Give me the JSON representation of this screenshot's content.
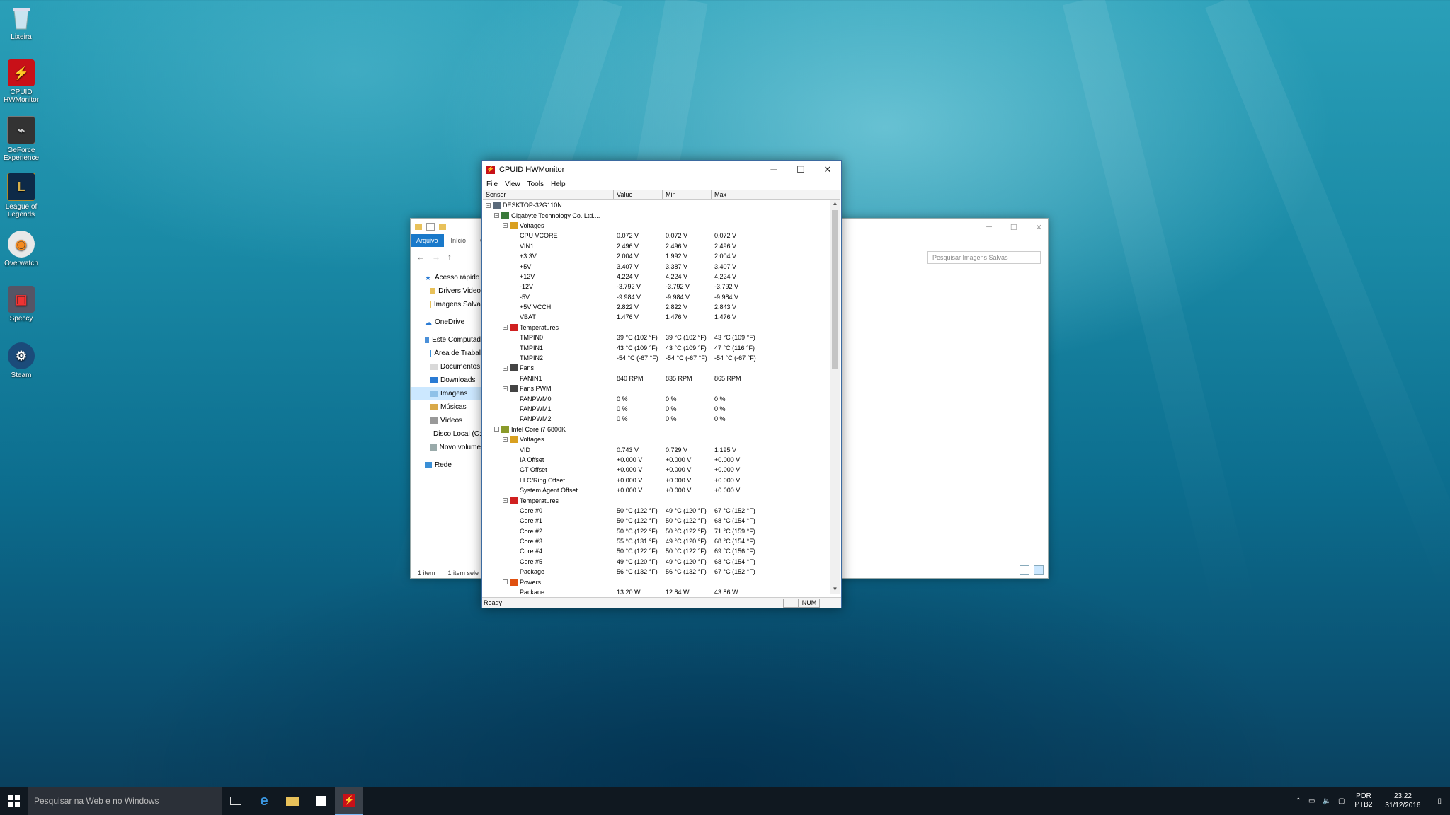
{
  "desktop": {
    "icons": [
      {
        "label": "Lixeira"
      },
      {
        "label": "CPUID HWMonitor"
      },
      {
        "label": "GeForce Experience"
      },
      {
        "label": "League of Legends"
      },
      {
        "label": "Overwatch"
      },
      {
        "label": "Speccy"
      },
      {
        "label": "Steam"
      }
    ]
  },
  "explorer": {
    "ribbon": {
      "file": "Arquivo",
      "home": "Início",
      "share": "C"
    },
    "search_placeholder": "Pesquisar Imagens Salvas",
    "nav": [
      "Acesso rápido",
      "Drivers Video",
      "Imagens Salva",
      "OneDrive",
      "Este Computad",
      "Área de Trabal",
      "Documentos",
      "Downloads",
      "Imagens",
      "Músicas",
      "Vídeos",
      "Disco Local (C:",
      "Novo volume",
      "Rede"
    ],
    "status": {
      "count": "1 item",
      "selected": "1 item sele"
    }
  },
  "hwmonitor": {
    "title": "CPUID HWMonitor",
    "menu": [
      "File",
      "View",
      "Tools",
      "Help"
    ],
    "columns": [
      "Sensor",
      "Value",
      "Min",
      "Max"
    ],
    "rows": [
      {
        "name": "DESKTOP-32G110N",
        "value": "",
        "min": "",
        "max": ""
      },
      {
        "name": "Gigabyte Technology Co. Ltd....",
        "value": "",
        "min": "",
        "max": ""
      },
      {
        "name": "Voltages",
        "value": "",
        "min": "",
        "max": ""
      },
      {
        "name": "CPU VCORE",
        "value": "0.072 V",
        "min": "0.072 V",
        "max": "0.072 V"
      },
      {
        "name": "VIN1",
        "value": "2.496 V",
        "min": "2.496 V",
        "max": "2.496 V"
      },
      {
        "name": "+3.3V",
        "value": "2.004 V",
        "min": "1.992 V",
        "max": "2.004 V"
      },
      {
        "name": "+5V",
        "value": "3.407 V",
        "min": "3.387 V",
        "max": "3.407 V"
      },
      {
        "name": "+12V",
        "value": "4.224 V",
        "min": "4.224 V",
        "max": "4.224 V"
      },
      {
        "name": "-12V",
        "value": "-3.792 V",
        "min": "-3.792 V",
        "max": "-3.792 V"
      },
      {
        "name": "-5V",
        "value": "-9.984 V",
        "min": "-9.984 V",
        "max": "-9.984 V"
      },
      {
        "name": "+5V VCCH",
        "value": "2.822 V",
        "min": "2.822 V",
        "max": "2.843 V"
      },
      {
        "name": "VBAT",
        "value": "1.476 V",
        "min": "1.476 V",
        "max": "1.476 V"
      },
      {
        "name": "Temperatures",
        "value": "",
        "min": "",
        "max": ""
      },
      {
        "name": "TMPIN0",
        "value": "39 °C  (102 °F)",
        "min": "39 °C  (102 °F)",
        "max": "43 °C  (109 °F)"
      },
      {
        "name": "TMPIN1",
        "value": "43 °C  (109 °F)",
        "min": "43 °C  (109 °F)",
        "max": "47 °C  (116 °F)"
      },
      {
        "name": "TMPIN2",
        "value": "-54 °C  (-67 °F)",
        "min": "-54 °C  (-67 °F)",
        "max": "-54 °C  (-67 °F)"
      },
      {
        "name": "Fans",
        "value": "",
        "min": "",
        "max": ""
      },
      {
        "name": "FANIN1",
        "value": "840 RPM",
        "min": "835 RPM",
        "max": "865 RPM"
      },
      {
        "name": "Fans PWM",
        "value": "",
        "min": "",
        "max": ""
      },
      {
        "name": "FANPWM0",
        "value": "0 %",
        "min": "0 %",
        "max": "0 %"
      },
      {
        "name": "FANPWM1",
        "value": "0 %",
        "min": "0 %",
        "max": "0 %"
      },
      {
        "name": "FANPWM2",
        "value": "0 %",
        "min": "0 %",
        "max": "0 %"
      },
      {
        "name": "Intel Core i7 6800K",
        "value": "",
        "min": "",
        "max": ""
      },
      {
        "name": "Voltages",
        "value": "",
        "min": "",
        "max": ""
      },
      {
        "name": "VID",
        "value": "0.743 V",
        "min": "0.729 V",
        "max": "1.195 V"
      },
      {
        "name": "IA Offset",
        "value": "+0.000 V",
        "min": "+0.000 V",
        "max": "+0.000 V"
      },
      {
        "name": "GT Offset",
        "value": "+0.000 V",
        "min": "+0.000 V",
        "max": "+0.000 V"
      },
      {
        "name": "LLC/Ring Offset",
        "value": "+0.000 V",
        "min": "+0.000 V",
        "max": "+0.000 V"
      },
      {
        "name": "System Agent Offset",
        "value": "+0.000 V",
        "min": "+0.000 V",
        "max": "+0.000 V"
      },
      {
        "name": "Temperatures",
        "value": "",
        "min": "",
        "max": ""
      },
      {
        "name": "Core #0",
        "value": "50 °C  (122 °F)",
        "min": "49 °C  (120 °F)",
        "max": "67 °C  (152 °F)"
      },
      {
        "name": "Core #1",
        "value": "50 °C  (122 °F)",
        "min": "50 °C  (122 °F)",
        "max": "68 °C  (154 °F)"
      },
      {
        "name": "Core #2",
        "value": "50 °C  (122 °F)",
        "min": "50 °C  (122 °F)",
        "max": "71 °C  (159 °F)"
      },
      {
        "name": "Core #3",
        "value": "55 °C  (131 °F)",
        "min": "49 °C  (120 °F)",
        "max": "68 °C  (154 °F)"
      },
      {
        "name": "Core #4",
        "value": "50 °C  (122 °F)",
        "min": "50 °C  (122 °F)",
        "max": "69 °C  (156 °F)"
      },
      {
        "name": "Core #5",
        "value": "49 °C  (120 °F)",
        "min": "49 °C  (120 °F)",
        "max": "68 °C  (154 °F)"
      },
      {
        "name": "Package",
        "value": "56 °C  (132 °F)",
        "min": "56 °C  (132 °F)",
        "max": "67 °C  (152 °F)"
      },
      {
        "name": "Powers",
        "value": "",
        "min": "",
        "max": ""
      },
      {
        "name": "Package",
        "value": "13.20 W",
        "min": "12.84 W",
        "max": "43.86 W"
      }
    ],
    "status": {
      "text": "Ready",
      "num": "NUM"
    }
  },
  "taskbar": {
    "search_placeholder": "Pesquisar na Web e no Windows",
    "lang_top": "POR",
    "lang_bottom": "PTB2",
    "time": "23:22",
    "date": "31/12/2016"
  }
}
